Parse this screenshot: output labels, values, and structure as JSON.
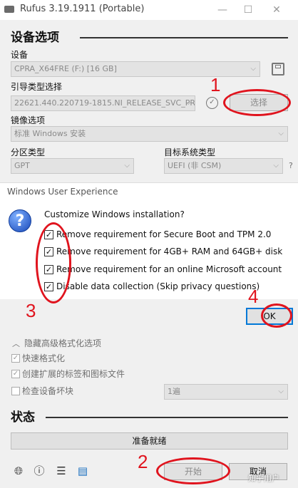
{
  "window": {
    "title": "Rufus 3.19.1911 (Portable)",
    "min_glyph": "—",
    "max_glyph": "☐",
    "close_glyph": "✕"
  },
  "device_options": {
    "heading": "设备选项",
    "device_label": "设备",
    "device_value": "CPRA_X64FRE (F:) [16 GB]",
    "boot_label": "引导类型选择",
    "boot_value": "22621.440.220719-1815.NI_RELEASE_SVC_PRC",
    "select_button": "选择",
    "image_label": "镜像选项",
    "image_value": "标准 Windows 安装",
    "partition_label": "分区类型",
    "partition_value": "GPT",
    "target_label": "目标系统类型",
    "target_value": "UEFI (非 CSM)",
    "help_glyph": "?"
  },
  "dialog": {
    "title": "Windows User Experience",
    "prompt": "Customize Windows installation?",
    "options": [
      {
        "label": "Remove requirement for Secure Boot and TPM 2.0",
        "checked": true
      },
      {
        "label": "Remove requirement for 4GB+ RAM and 64GB+ disk",
        "checked": true
      },
      {
        "label": "Remove requirement for an online Microsoft account",
        "checked": true
      },
      {
        "label": "Disable data collection (Skip privacy questions)",
        "checked": true
      }
    ],
    "ok_button": "OK",
    "question_glyph": "?"
  },
  "format_options": {
    "toggle_label": "隐藏高级格式化选项",
    "quick_format": "快速格式化",
    "extended_label": "创建扩展的标签和图标文件",
    "check_bad": "检查设备坏块",
    "passes_value": "1遍"
  },
  "status": {
    "heading": "状态",
    "text": "准备就绪"
  },
  "footer": {
    "start_button": "开始",
    "cancel_button": "取消",
    "watermark": "知乎用户"
  },
  "annotations": [
    "1",
    "2",
    "3",
    "4"
  ],
  "colors": {
    "annotation_red": "#e0141e",
    "ok_border": "#0078d7"
  }
}
